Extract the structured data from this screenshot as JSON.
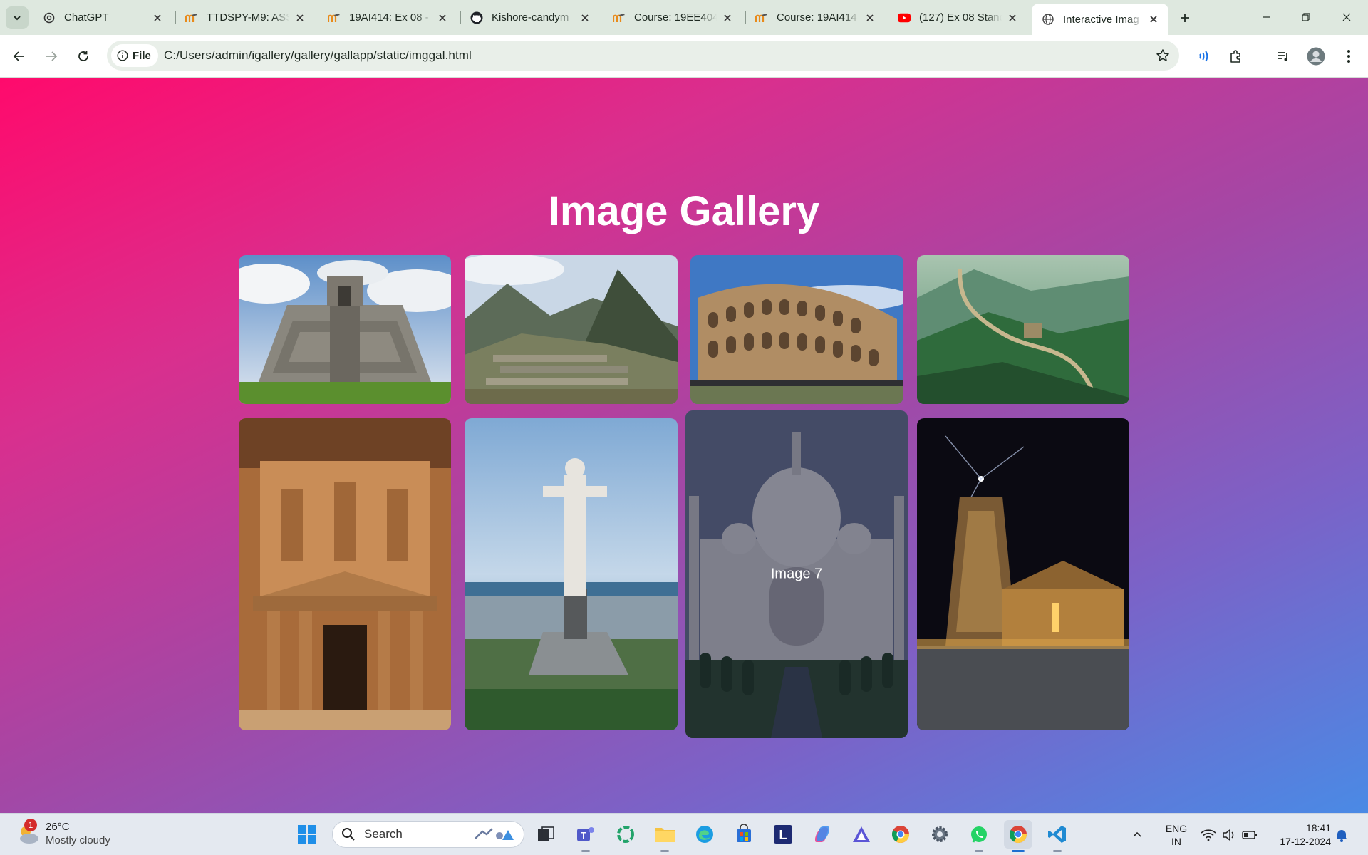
{
  "browser": {
    "tabs": [
      {
        "title": "ChatGPT",
        "icon": "chatgpt-icon",
        "active": false
      },
      {
        "title": "TTDSPY-M9: ASS",
        "icon": "moodle-icon",
        "active": false
      },
      {
        "title": "19AI414: Ex 08 -",
        "icon": "moodle-icon",
        "active": false
      },
      {
        "title": "Kishore-candym",
        "icon": "github-icon",
        "active": false
      },
      {
        "title": "Course: 19EE404",
        "icon": "moodle-icon",
        "active": false
      },
      {
        "title": "Course: 19AI414",
        "icon": "moodle-icon",
        "active": false
      },
      {
        "title": "(127) Ex 08 Stand",
        "icon": "youtube-icon",
        "active": false
      },
      {
        "title": "Interactive Imag",
        "icon": "globe-icon",
        "active": true
      }
    ],
    "site_chip_label": "File",
    "url": "C:/Users/admin/igallery/gallery/gallapp/static/imggal.html"
  },
  "page": {
    "title": "Image Gallery",
    "images": [
      {
        "alt": "Chichen Itza pyramid",
        "label": ""
      },
      {
        "alt": "Machu Picchu",
        "label": ""
      },
      {
        "alt": "Colosseum",
        "label": ""
      },
      {
        "alt": "Great Wall of China",
        "label": ""
      },
      {
        "alt": "Petra Treasury",
        "label": ""
      },
      {
        "alt": "Christ the Redeemer",
        "label": ""
      },
      {
        "alt": "Taj Mahal",
        "label": "Image 7",
        "hovered": true
      },
      {
        "alt": "Brihadeeswarar Temple",
        "label": ""
      }
    ]
  },
  "taskbar": {
    "weather": {
      "temp": "26°C",
      "condition": "Mostly cloudy",
      "badge": "1"
    },
    "search_label": "Search",
    "lang_line1": "ENG",
    "lang_line2": "IN",
    "time": "18:41",
    "date": "17-12-2024"
  },
  "colors": {
    "gradient_start": "#ff0a6c",
    "gradient_mid": "#a447a5",
    "gradient_end": "#4a8ae5"
  }
}
